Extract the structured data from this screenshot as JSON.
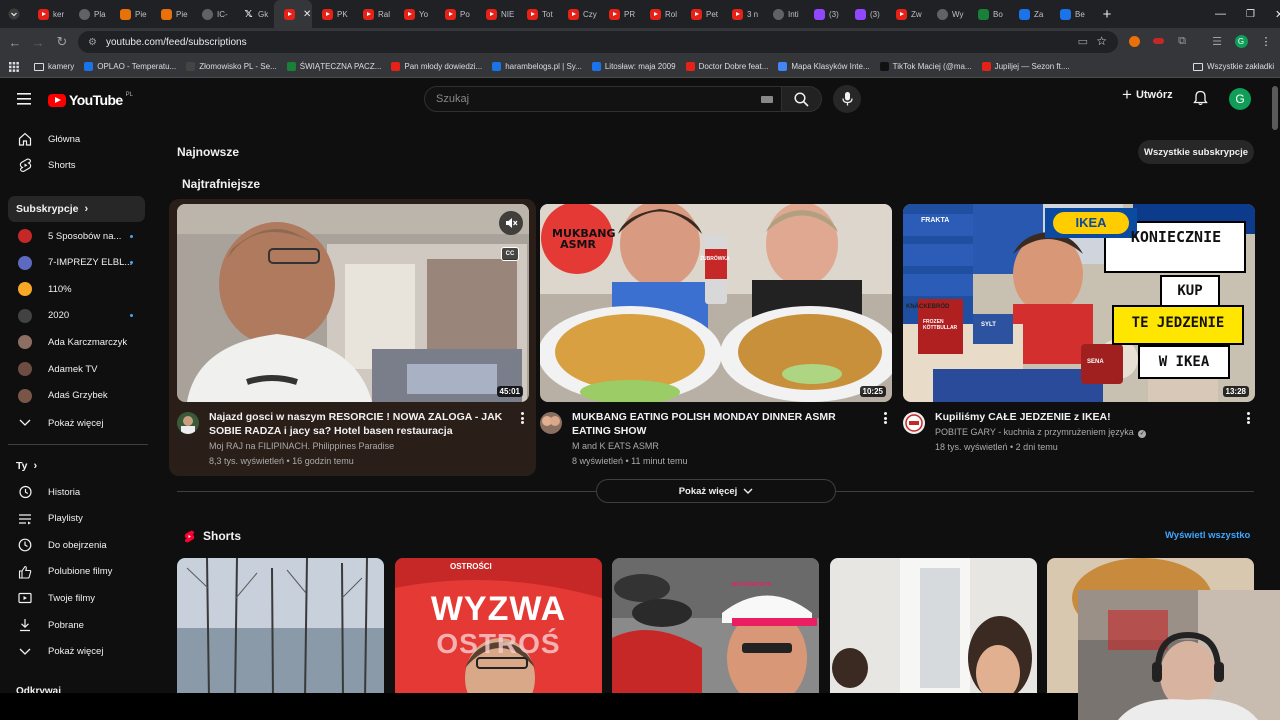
{
  "browser": {
    "tabs": [
      {
        "label": "ker",
        "icon": "youtube-icon"
      },
      {
        "label": "Pla",
        "icon": "google-icon"
      },
      {
        "label": "Pie",
        "icon": "orange-icon"
      },
      {
        "label": "Pie",
        "icon": "orange-icon"
      },
      {
        "label": "IC-",
        "icon": "globe-icon"
      },
      {
        "label": "Gk",
        "icon": "x-icon"
      },
      {
        "label": "",
        "icon": "youtube-icon",
        "active": true
      },
      {
        "label": "PK",
        "icon": "youtube-icon"
      },
      {
        "label": "Ral",
        "icon": "youtube-icon"
      },
      {
        "label": "Yo",
        "icon": "youtube-icon"
      },
      {
        "label": "Po",
        "icon": "youtube-icon"
      },
      {
        "label": "NIE",
        "icon": "youtube-icon"
      },
      {
        "label": "Tot",
        "icon": "youtube-icon"
      },
      {
        "label": "Czy",
        "icon": "youtube-icon"
      },
      {
        "label": "PR",
        "icon": "youtube-icon"
      },
      {
        "label": "Rol",
        "icon": "youtube-icon"
      },
      {
        "label": "Pet",
        "icon": "youtube-icon"
      },
      {
        "label": "3 n",
        "icon": "youtube-icon"
      },
      {
        "label": "Inti",
        "icon": "grey-icon"
      },
      {
        "label": "(3)",
        "icon": "twitch-icon"
      },
      {
        "label": "(3)",
        "icon": "twitch-icon"
      },
      {
        "label": "Zw",
        "icon": "red-icon"
      },
      {
        "label": "Wy",
        "icon": "grey-icon"
      },
      {
        "label": "Bo",
        "icon": "green-icon"
      },
      {
        "label": "Za",
        "icon": "blue-icon"
      },
      {
        "label": "Be",
        "icon": "blue-icon"
      }
    ],
    "new_tab": "+",
    "url": "youtube.com/feed/subscriptions",
    "bookmarks": [
      "kamery",
      "OPLAO - Temperatu...",
      "Złomowisko PL - Se...",
      "ŚWIĄTECZNA PACZ...",
      "Pan młody dowiedzi...",
      "harambelogs.pl | Sy...",
      "Litosław: maja 2009",
      "Doctor Dobre feat...",
      "Mapa Klasyków Inte...",
      "TikTok Maciej (@ma...",
      "Jupiljej — Sezon ft...."
    ],
    "all_bookmarks": "Wszystkie zakładki"
  },
  "yt": {
    "logo_text": "YouTube",
    "logo_region": "PL",
    "search_placeholder": "Szukaj",
    "create_label": "Utwórz",
    "avatar_letter": "G",
    "nav": [
      {
        "label": "Główna",
        "icon": "home-icon"
      },
      {
        "label": "Shorts",
        "icon": "shorts-icon"
      }
    ],
    "subs_header": "Subskrypcje",
    "subs": [
      {
        "label": "5 Sposobów na...",
        "color": "#c62828",
        "dot": true
      },
      {
        "label": "7-IMPREZY ELBL...",
        "color": "#5c6bc0",
        "dot": true
      },
      {
        "label": "110%",
        "color": "#f9a825",
        "dot": false
      },
      {
        "label": "2020",
        "color": "#424242",
        "dot": true
      },
      {
        "label": "Ada Karczmarczyk",
        "color": "#8d6e63",
        "dot": false
      },
      {
        "label": "Adamek TV",
        "color": "#6d4c41",
        "dot": false
      },
      {
        "label": "Adaś Grzybek",
        "color": "#795548",
        "dot": false
      }
    ],
    "subs_more": "Pokaż więcej",
    "you_header": "Ty",
    "you": [
      {
        "label": "Historia",
        "icon": "history-icon"
      },
      {
        "label": "Playlisty",
        "icon": "playlist-icon"
      },
      {
        "label": "Do obejrzenia",
        "icon": "watch-later-icon"
      },
      {
        "label": "Polubione filmy",
        "icon": "like-icon"
      },
      {
        "label": "Twoje filmy",
        "icon": "your-videos-icon"
      },
      {
        "label": "Pobrane",
        "icon": "download-icon"
      },
      {
        "label": "Pokaż więcej",
        "icon": "chevron-down-icon"
      }
    ],
    "explore_header": "Odkrywaj"
  },
  "feed": {
    "latest_title": "Najnowsze",
    "all_subs_label": "Wszystkie subskrypcje",
    "relevant_title": "Najtrafniejsze",
    "videos": [
      {
        "title": "Najazd gosci w naszym RESORCIE ! NOWA ZALOGA - JAK SOBIE RADZA i jacy sa?  Hotel basen restauracja",
        "channel": "Moj RAJ na FILIPINACH. Philippines Paradise",
        "meta": "8,3 tys. wyświetleń • 16 godzin temu",
        "duration": "45:01",
        "cc": "CC"
      },
      {
        "title": "MUKBANG EATING POLISH MONDAY DINNER ASMR EATING SHOW",
        "channel": "M and K EATS ASMR",
        "meta": "8 wyświetleń • 11 minut temu",
        "duration": "10:25",
        "thumb_text": "MUKBANG ASMR",
        "can_text": "ŻUBRÓWKA"
      },
      {
        "title": "Kupiliśmy CAŁE JEDZENIE z IKEA!",
        "channel": "POBITE GARY - kuchnia z przymrużeniem języka",
        "meta": "18 tys. wyświetleń • 2 dni temu",
        "duration": "13:28",
        "thumb_lines": [
          "KONIECZNIE",
          "KUP",
          "TE JEDZENIE",
          "W IKEA"
        ],
        "ikea": "IKEA",
        "frakta": "FRAKTA",
        "knackebrod": "KNÄCKEBRÖD",
        "frozen": "FROZEN KÖTTBULLAR",
        "sylt": "SYLT",
        "sena": "SENA"
      }
    ],
    "more_label": "Pokaż więcej",
    "shorts_title": "Shorts",
    "shorts_all": "Wyświetl wszystko",
    "short_texts": [
      "",
      "WYZWA",
      "",
      "",
      ""
    ],
    "short_sub": "OSTROŚCI",
    "short_sub2": "OSTROŚ",
    "short_cap": "MOTORSPORTS"
  }
}
